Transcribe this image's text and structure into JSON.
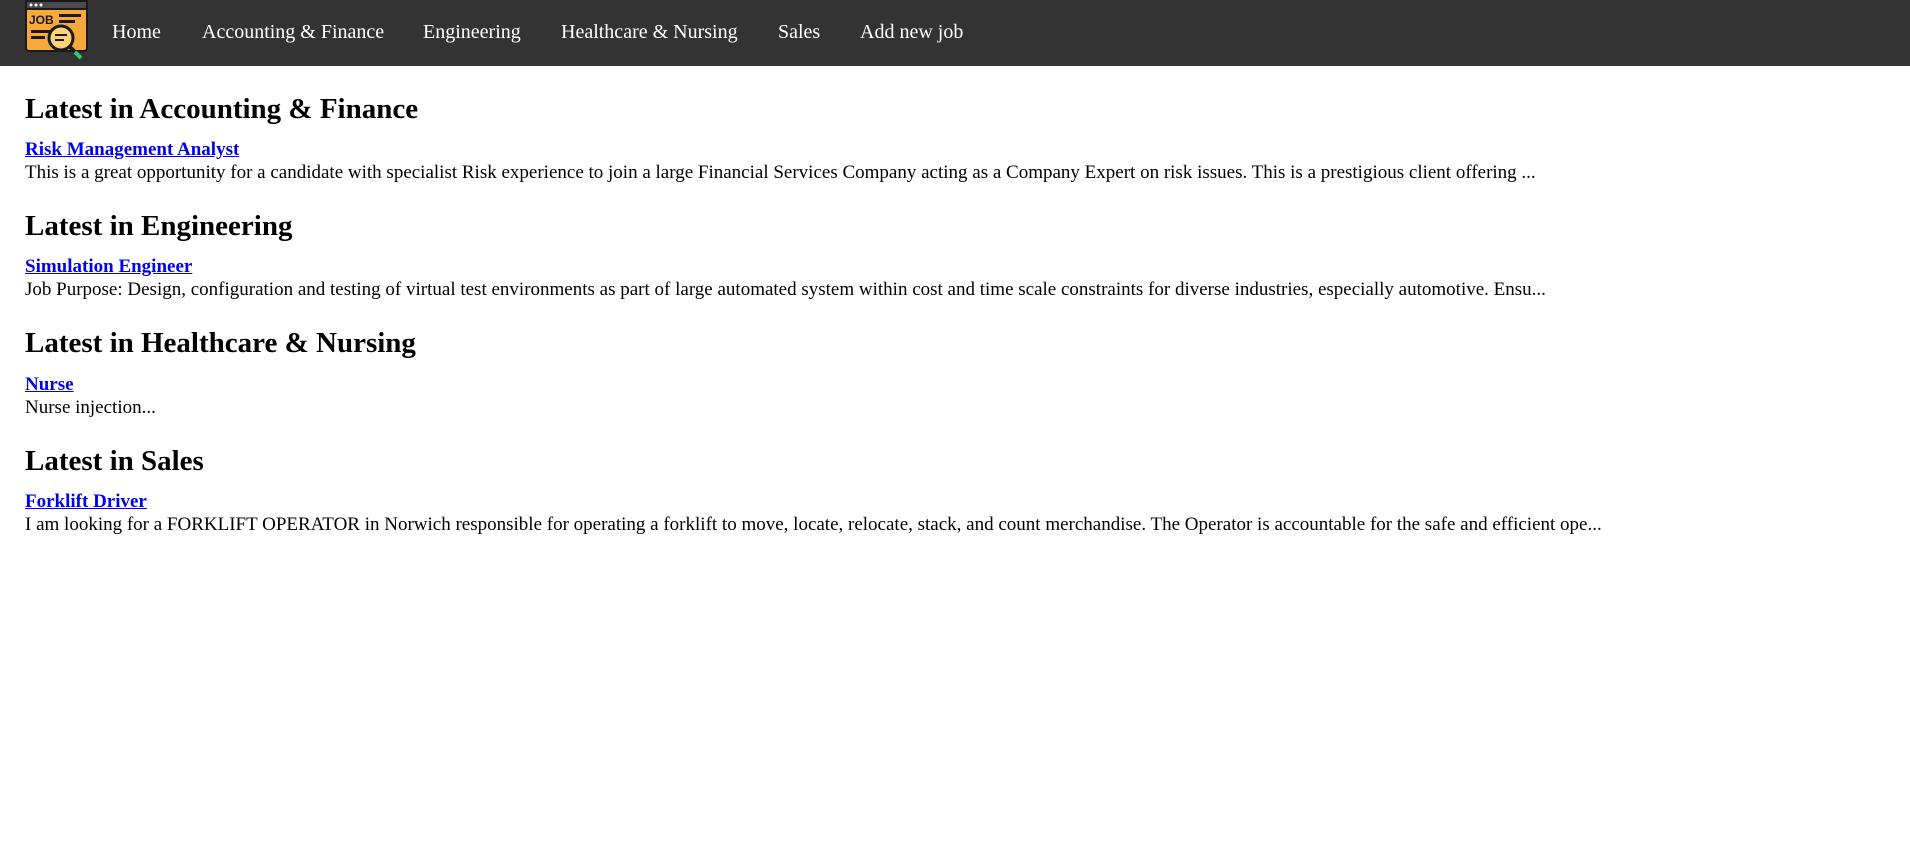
{
  "colors": {
    "nav_background": "#333333",
    "nav_text": "#ffffff",
    "link": "#0000ee",
    "logo_orange": "#f7a93b"
  },
  "logo": {
    "icon": "job-search-logo-icon",
    "text": "JOB"
  },
  "nav": {
    "items": [
      {
        "label": "Home"
      },
      {
        "label": "Accounting & Finance"
      },
      {
        "label": "Engineering"
      },
      {
        "label": "Healthcare & Nursing"
      },
      {
        "label": "Sales"
      },
      {
        "label": "Add new job"
      }
    ]
  },
  "sections": [
    {
      "title": "Latest in Accounting & Finance",
      "job_title": "Risk Management Analyst",
      "description": "This is a great opportunity for a candidate with specialist Risk experience to join a large Financial Services Company acting as a Company Expert on risk issues. This is a prestigious client offering ..."
    },
    {
      "title": "Latest in Engineering",
      "job_title": "Simulation Engineer",
      "description": "Job Purpose: Design, configuration and testing of virtual test environments as part of large automated system within cost and time scale constraints for diverse industries, especially automotive. Ensu..."
    },
    {
      "title": "Latest in Healthcare & Nursing",
      "job_title": "Nurse",
      "description": "Nurse injection..."
    },
    {
      "title": "Latest in Sales",
      "job_title": "Forklift Driver",
      "description": "I am looking for a FORKLIFT OPERATOR in Norwich responsible for operating a forklift to move, locate, relocate, stack, and count merchandise. The Operator is accountable for the safe and efficient ope..."
    }
  ]
}
